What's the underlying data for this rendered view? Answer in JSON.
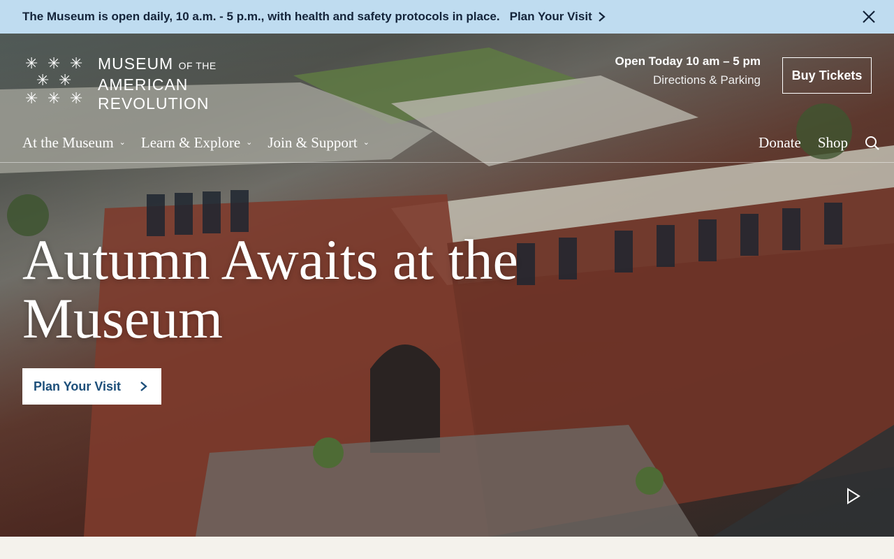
{
  "alert": {
    "message": "The Museum is open daily, 10 a.m. - 5 p.m., with health and safety protocols in place.",
    "link_label": "Plan Your Visit",
    "close_icon": "close-icon"
  },
  "header": {
    "logo": {
      "line1": "MUSEUM",
      "line1_small": "OF THE",
      "line2": "AMERICAN",
      "line3": "REVOLUTION",
      "icon": "stars-logo-icon"
    },
    "hours": {
      "open_today": "Open Today 10 am – 5 pm",
      "directions": "Directions & Parking"
    },
    "buy_tickets": "Buy Tickets"
  },
  "nav": {
    "items": [
      {
        "label": "At the Museum"
      },
      {
        "label": "Learn & Explore"
      },
      {
        "label": "Join & Support"
      }
    ],
    "right": {
      "donate": "Donate",
      "shop": "Shop",
      "search_icon": "search-icon"
    }
  },
  "hero": {
    "headline": "Autumn Awaits at the Museum",
    "cta_label": "Plan Your Visit",
    "play_icon": "play-icon"
  },
  "colors": {
    "alert_bg": "#bfdcf0",
    "cta_text": "#1d4f7a",
    "footer_bg": "#f4f2ec"
  }
}
